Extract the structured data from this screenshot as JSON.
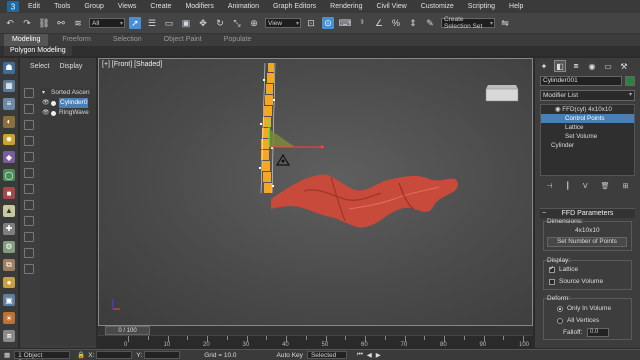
{
  "menubar": {
    "items": [
      "Edit",
      "Tools",
      "Group",
      "Views",
      "Create",
      "Modifiers",
      "Animation",
      "Graph Editors",
      "Rendering",
      "Civil View",
      "Customize",
      "Scripting",
      "Help"
    ]
  },
  "toolbar": {
    "filter_value": "All",
    "view_value": "View",
    "selection_set_placeholder": "Create Selection Set"
  },
  "ribbon": {
    "tabs": [
      "Modeling",
      "Freeform",
      "Selection",
      "Object Paint",
      "Populate"
    ],
    "active_sub": "Polygon Modeling"
  },
  "scene_explorer": {
    "tabs": [
      "Select",
      "Display"
    ],
    "header": "Sorted Ascen",
    "items": [
      "Cylinder0",
      "RingWave"
    ]
  },
  "viewport": {
    "label": "[+] [Front] [Shaded]"
  },
  "timeslider": {
    "position_label": "0 / 100",
    "ticks": [
      "0",
      "10",
      "20",
      "30",
      "40",
      "50",
      "60",
      "70",
      "80",
      "90",
      "100"
    ]
  },
  "statusbar": {
    "selection_text": "1 Object Selected",
    "x_label": "X:",
    "y_label": "Y:",
    "grid_text": "Grid = 10.0",
    "autokey_label": "Auto Key",
    "selected_dropdown": "Selected"
  },
  "command_panel": {
    "object_name": "Cylinder001",
    "modifier_list_label": "Modifier List",
    "stack": [
      {
        "label": "FFD(cyl) 4x10x10",
        "indent": 1,
        "selected": false
      },
      {
        "label": "Control Points",
        "indent": 2,
        "selected": true
      },
      {
        "label": "Lattice",
        "indent": 2,
        "selected": false
      },
      {
        "label": "Set Volume",
        "indent": 2,
        "selected": false
      },
      {
        "label": "Cylinder",
        "indent": 0,
        "selected": false
      }
    ],
    "rollout_title": "FFD Parameters",
    "dimensions_label": "Dimensions:",
    "dimensions_value": "4x10x10",
    "set_points_button": "Set Number of Points",
    "display_label": "Display:",
    "lattice_label": "Lattice",
    "lattice_checked": true,
    "source_volume_label": "Source Volume",
    "source_volume_checked": false,
    "deform_label": "Deform:",
    "only_in_volume_label": "Only In Volume",
    "all_vertices_label": "All Vertices",
    "falloff_label": "Falloff:",
    "falloff_value": "0.0"
  },
  "colors": {
    "lattice_orange": "#f5a623",
    "mesh_red": "#c84a3a",
    "selection_blue": "#4a7fb5",
    "object_color": "#2f7f3f"
  }
}
